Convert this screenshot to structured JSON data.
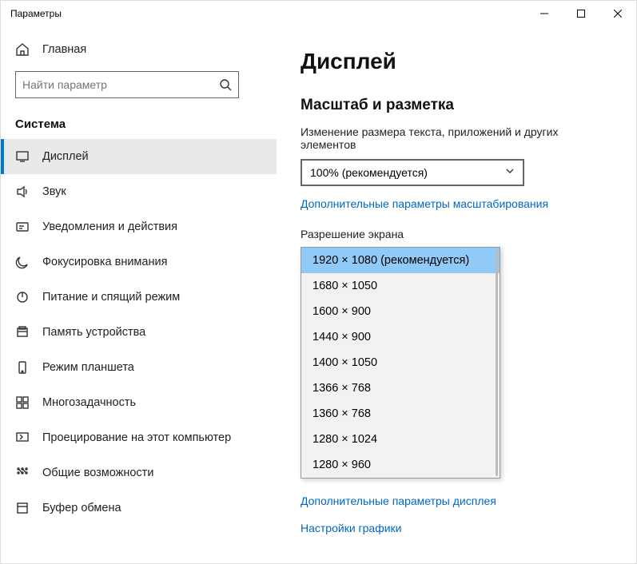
{
  "window": {
    "title": "Параметры"
  },
  "sidebar": {
    "home": "Главная",
    "search_placeholder": "Найти параметр",
    "section": "Система",
    "items": [
      {
        "label": "Дисплей",
        "active": true
      },
      {
        "label": "Звук"
      },
      {
        "label": "Уведомления и действия"
      },
      {
        "label": "Фокусировка внимания"
      },
      {
        "label": "Питание и спящий режим"
      },
      {
        "label": "Память устройства"
      },
      {
        "label": "Режим планшета"
      },
      {
        "label": "Многозадачность"
      },
      {
        "label": "Проецирование на этот компьютер"
      },
      {
        "label": "Общие возможности"
      },
      {
        "label": "Буфер обмена"
      }
    ]
  },
  "content": {
    "title": "Дисплей",
    "scale_group": "Масштаб и разметка",
    "scale_label": "Изменение размера текста, приложений и других элементов",
    "scale_value": "100% (рекомендуется)",
    "scale_link": "Дополнительные параметры масштабирования",
    "resolution_label": "Разрешение экрана",
    "resolutions": [
      "1920 × 1080 (рекомендуется)",
      "1680 × 1050",
      "1600 × 900",
      "1440 × 900",
      "1400 × 1050",
      "1366 × 768",
      "1360 × 768",
      "1280 × 1024",
      "1280 × 960"
    ],
    "advanced_display_link": "Дополнительные параметры дисплея",
    "graphics_link": "Настройки графики"
  }
}
